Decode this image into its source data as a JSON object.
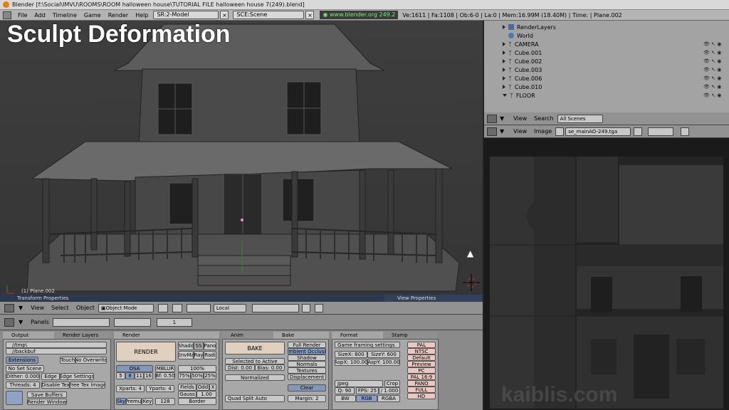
{
  "window": {
    "title": "Blender [f:\\Social\\IMVU\\ROOMS\\ROOM halloween house\\TUTORIAL FILE halloween house 7(249).blend]"
  },
  "menu": {
    "items": [
      "File",
      "Add",
      "Timeline",
      "Game",
      "Render",
      "Help"
    ],
    "screen": "SR:2-Model",
    "scene": "SCE:Scene",
    "url": "www.blender.org 249.2",
    "stats": "Ve:1611 | Fa:1108 | Ob:6-0 | La:0 | Mem:16.99M (18.40M) | Time: | Plane.002"
  },
  "viewport": {
    "overlay_title": "Sculpt Deformation",
    "object_label": "(1) Plane.002"
  },
  "viewheader": {
    "view": "View",
    "select": "Select",
    "object": "Object",
    "mode": "Object Mode",
    "local": "Local"
  },
  "transform_panel": {
    "title": "Transform Properties"
  },
  "view_panel": {
    "title": "View Properties"
  },
  "outliner": {
    "rows": [
      {
        "name": "RenderLayers",
        "indent": 0
      },
      {
        "name": "World",
        "indent": 1
      },
      {
        "name": "CAMERA",
        "indent": 0
      },
      {
        "name": "Cube.001",
        "indent": 0
      },
      {
        "name": "Cube.002",
        "indent": 0
      },
      {
        "name": "Cube.003",
        "indent": 0
      },
      {
        "name": "Cube.006",
        "indent": 0
      },
      {
        "name": "Cube.010",
        "indent": 0
      },
      {
        "name": "FLOOR",
        "indent": 0
      }
    ],
    "header": {
      "view": "View",
      "search": "Search",
      "scenes": "All Scenes"
    }
  },
  "image_editor": {
    "view": "View",
    "image": "Image",
    "filename": "se_mainAO-249.tga"
  },
  "buttons_header": {
    "panels": "Panels",
    "page": "1"
  },
  "output": {
    "tab1": "Output",
    "tab2": "Render Layers",
    "path1": "//tmp\\",
    "path2": "//backbuf",
    "extensions": "Extensions",
    "touch": "Touch",
    "no_overwrite": "No Overwrite",
    "no_set_scene": "No Set Scene",
    "dither": "Dither: 0.000",
    "edge": "Edge",
    "edge_settings": "Edge Settings",
    "threads": "Threads: 4",
    "disable_tex": "Disable Tex",
    "free_tex": "Free Tex Image",
    "save_buffers": "Save Buffers",
    "render_window": "Render Window"
  },
  "render": {
    "tab": "Render",
    "render_btn": "RENDER",
    "osa": "OSA",
    "osa_vals": [
      "5",
      "8",
      "11",
      "16"
    ],
    "mblur": "MBLUR",
    "bf": "Bf: 0.50",
    "shadow": "Shado",
    "ss": "SS",
    "pano": "Pano",
    "envmap": "EnvMa",
    "ray": "Ray",
    "radio": "Radi",
    "pct": "100%",
    "pcts": [
      "75%",
      "50%",
      "25%"
    ],
    "xparts": "Xparts: 4",
    "yparts": "Yparts: 4",
    "fields": "Fields",
    "odd": "Odd",
    "x": "X",
    "gauss": "Gauss",
    "gauss_val": "1.00",
    "sky": "Sky",
    "premul": "Premul",
    "key": "Key",
    "num": "128",
    "border": "Border"
  },
  "bake": {
    "tab1": "Anim",
    "tab2": "Bake",
    "bake_btn": "BAKE",
    "full_render": "Full Render",
    "ambient": "Ambient Occlusio",
    "shadow": "Shadow",
    "normals": "Normals",
    "textures": "Textures",
    "displacement": "Displacement",
    "sel_active": "Selected to Active",
    "dist": "Dist: 0.00",
    "bias": "Bias: 0.00",
    "normalized": "Normalized",
    "clear": "Clear",
    "quad": "Quad Split Auto",
    "margin": "Margin: 2"
  },
  "format": {
    "tab1": "Format",
    "tab2": "Stamp",
    "game": "Game framing settings",
    "sizex": "SizeX: 800",
    "sizey": "SizeY: 600",
    "aspx": "AspX: 100.00",
    "aspy": "AspY: 100.00",
    "presets": [
      "PAL",
      "NTSC",
      "Default",
      "Preview",
      "PC",
      "PAL 16:9",
      "PANO",
      "FULL",
      "HD"
    ],
    "jpeg": "Jpeg",
    "crop": "Crop",
    "q": "Q: 90",
    "fps": "FPS: 25",
    "fps_div": "/ 1.000",
    "bw": "BW",
    "rgb": "RGB",
    "rgba": "RGBA"
  },
  "watermark": "kaiblis.com"
}
